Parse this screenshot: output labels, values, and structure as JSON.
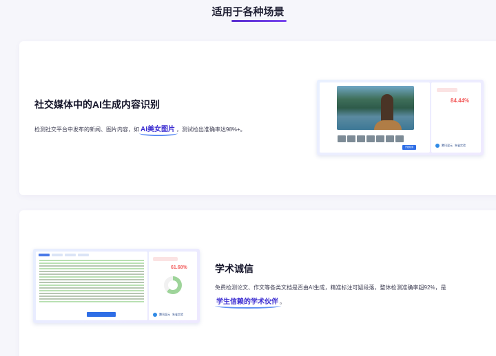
{
  "header": {
    "title": "适用于各种场景"
  },
  "scene1": {
    "title": "社交媒体中的AI生成内容识别",
    "desc_prefix": "检测社交平台中发布的新闻、图片内容，如",
    "highlight": "AI美女图片",
    "desc_suffix": "，测试检出准确率达98%+。",
    "mock": {
      "percent": "84.44%",
      "button": "开始检测",
      "logo1": "腾讯混元",
      "logo2": "朱雀实验"
    }
  },
  "scene2": {
    "title": "学术诚信",
    "desc": "免费检测论文、作文等各类文档是否由AI生成，精准标注可疑段落，整体检测准确率超92%，是",
    "highlight": "学生信赖的学术伙伴",
    "desc_suffix": "。",
    "mock": {
      "percent": "61.68%",
      "logo1": "腾讯混元",
      "logo2": "朱雀实验"
    }
  },
  "colors": {
    "accent": "#5a2fd0",
    "link": "#3a2bd0",
    "alert": "#f25a5a",
    "primary_button": "#2f6ee6"
  }
}
